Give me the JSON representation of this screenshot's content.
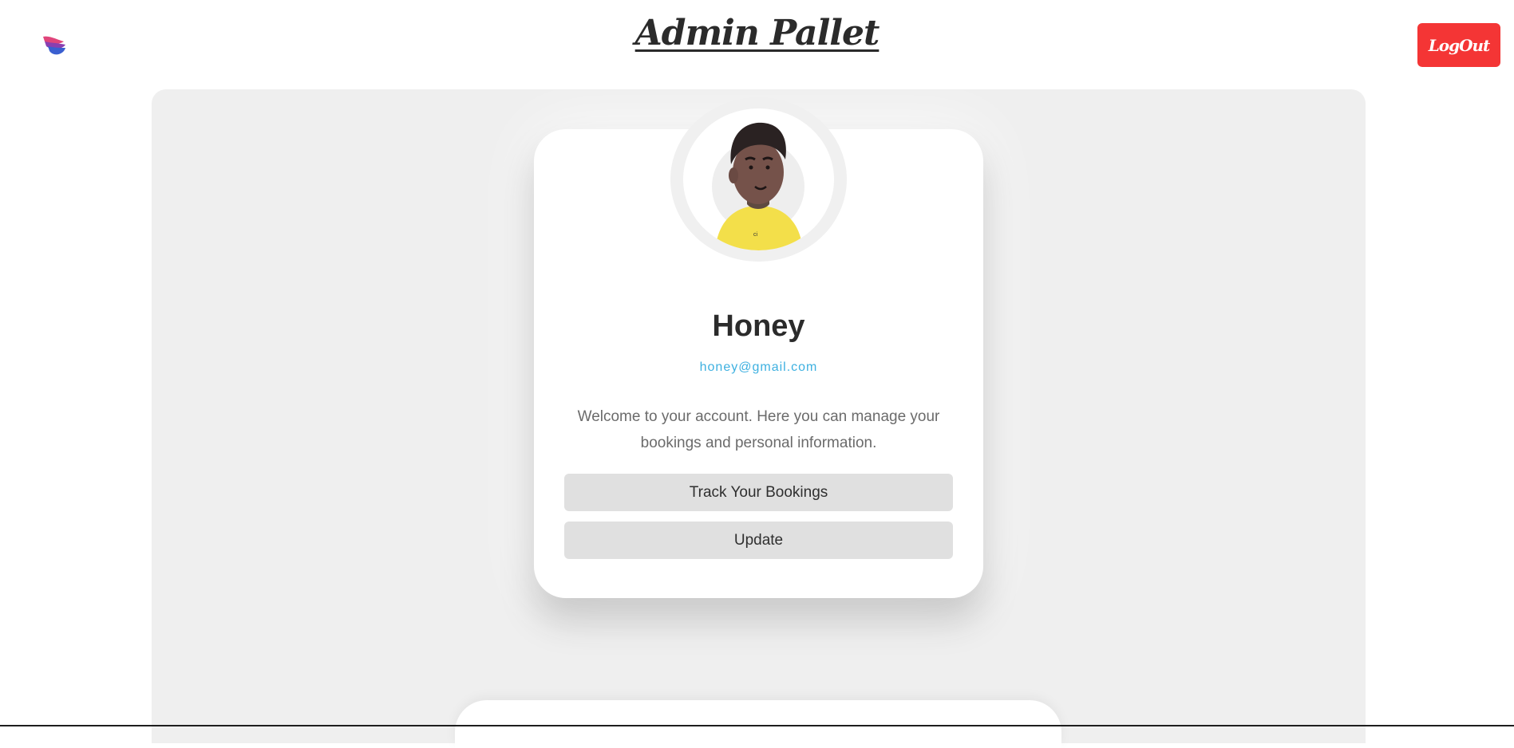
{
  "header": {
    "title": "Admin Pallet",
    "logout_label": "LogOut",
    "logo_icon": "app-logo-icon"
  },
  "profile": {
    "name": "Honey",
    "email": "honey@gmail.com",
    "welcome": "Welcome to your account. Here you can manage your bookings and personal information.",
    "avatar_icon": "user-avatar-icon",
    "track_label": "Track Your Bookings",
    "update_label": "Update"
  },
  "colors": {
    "logout_bg": "#f43535",
    "email": "#3db0e0",
    "panel_bg": "#efefef",
    "button_bg": "#e0e0e0"
  }
}
